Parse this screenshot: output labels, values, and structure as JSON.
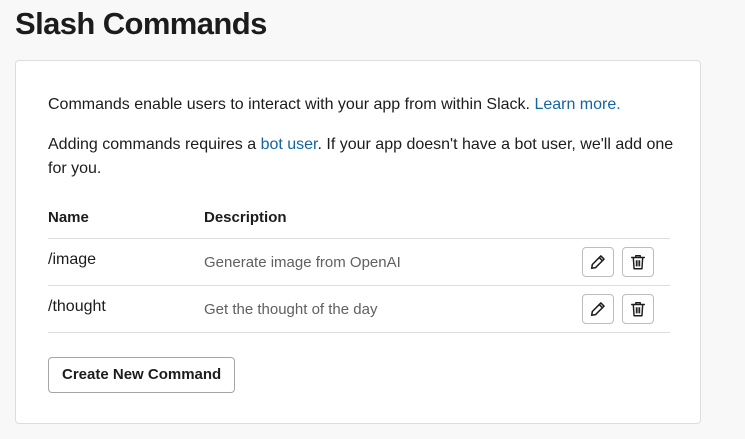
{
  "page": {
    "title": "Slash Commands"
  },
  "intro": {
    "text_before_link": "Commands enable users to interact with your app from within Slack. ",
    "learn_more_link": "Learn more.",
    "bot_text_before": "Adding commands requires a ",
    "bot_user_link": "bot user",
    "bot_text_after": ". If your app doesn't have a bot user, we'll add one for you."
  },
  "table": {
    "headers": {
      "name": "Name",
      "description": "Description"
    },
    "rows": [
      {
        "name": "/image",
        "description": "Generate image from OpenAI",
        "edit_icon": "pencil-icon",
        "delete_icon": "trash-icon"
      },
      {
        "name": "/thought",
        "description": "Get the thought of the day",
        "edit_icon": "pencil-icon",
        "delete_icon": "trash-icon"
      }
    ]
  },
  "actions": {
    "create_label": "Create New Command"
  },
  "colors": {
    "link": "#1264a3",
    "text": "#1d1c1d",
    "muted_text": "#616061",
    "border": "#dddddd",
    "background": "#f8f8f8"
  }
}
